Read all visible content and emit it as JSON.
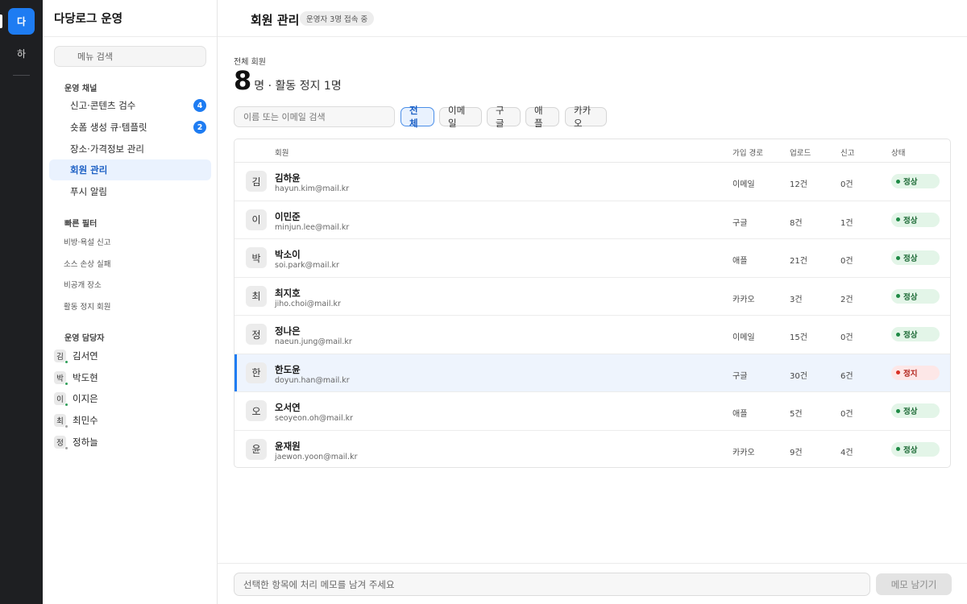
{
  "rail": {
    "active_label": "다",
    "second_label": "하"
  },
  "sidebar": {
    "title": "다당로그 운영",
    "search_placeholder": "메뉴 검색",
    "sections": {
      "channel_title": "운영 채널",
      "filters_title": "빠른 필터",
      "staff_title": "운영 담당자"
    },
    "menu": [
      {
        "label": "신고·콘텐츠 검수",
        "badge": "4"
      },
      {
        "label": "숏폼 생성 큐·템플릿",
        "badge": "2"
      },
      {
        "label": "장소·가격정보 관리"
      },
      {
        "label": "회원 관리",
        "active": true
      },
      {
        "label": "푸시 알림"
      }
    ],
    "filters": [
      "비방·욕설 신고",
      "소스 손상 실패",
      "비공개 장소",
      "활동 정지 회원"
    ],
    "staff": [
      {
        "initial": "김",
        "name": "김서연",
        "presence": "online"
      },
      {
        "initial": "박",
        "name": "박도현",
        "presence": "online"
      },
      {
        "initial": "이",
        "name": "이지은",
        "presence": "online"
      },
      {
        "initial": "최",
        "name": "최민수",
        "presence": "away"
      },
      {
        "initial": "정",
        "name": "정하늘",
        "presence": "away"
      }
    ]
  },
  "header": {
    "title": "회원 관리",
    "status": "운영자 3명 접속 중"
  },
  "summary": {
    "label": "전체 회원",
    "count": "8",
    "rest": "명 · 활동 정지 1명"
  },
  "search": {
    "placeholder": "이름 또는 이메일 검색"
  },
  "chips": [
    "전체",
    "이메일",
    "구글",
    "애플",
    "카카오"
  ],
  "table": {
    "headers": {
      "member": "회원",
      "path": "가입 경로",
      "uploads": "업로드",
      "reports": "신고",
      "status": "상태"
    },
    "rows": [
      {
        "initial": "김",
        "name": "김하윤",
        "email": "hayun.kim@mail.kr",
        "path": "이메일",
        "uploads": "12건",
        "reports": "0건",
        "status": "정상"
      },
      {
        "initial": "이",
        "name": "이민준",
        "email": "minjun.lee@mail.kr",
        "path": "구글",
        "uploads": "8건",
        "reports": "1건",
        "status": "정상"
      },
      {
        "initial": "박",
        "name": "박소이",
        "email": "soi.park@mail.kr",
        "path": "애플",
        "uploads": "21건",
        "reports": "0건",
        "status": "정상"
      },
      {
        "initial": "최",
        "name": "최지호",
        "email": "jiho.choi@mail.kr",
        "path": "카카오",
        "uploads": "3건",
        "reports": "2건",
        "status": "정상"
      },
      {
        "initial": "정",
        "name": "정나은",
        "email": "naeun.jung@mail.kr",
        "path": "이메일",
        "uploads": "15건",
        "reports": "0건",
        "status": "정상"
      },
      {
        "initial": "한",
        "name": "한도윤",
        "email": "doyun.han@mail.kr",
        "path": "구글",
        "uploads": "30건",
        "reports": "6건",
        "status": "정지"
      },
      {
        "initial": "오",
        "name": "오서연",
        "email": "seoyeon.oh@mail.kr",
        "path": "애플",
        "uploads": "5건",
        "reports": "0건",
        "status": "정상"
      },
      {
        "initial": "윤",
        "name": "윤재원",
        "email": "jaewon.yoon@mail.kr",
        "path": "카카오",
        "uploads": "9건",
        "reports": "4건",
        "status": "정상"
      }
    ]
  },
  "footer": {
    "memo_placeholder": "선택한 항목에 처리 메모를 남겨 주세요",
    "memo_button": "메모 남기기"
  },
  "colors": {
    "accent": "#1e7cf2",
    "rail": "#1e1f22",
    "ok": "#1e8a45",
    "stop": "#d93025"
  }
}
